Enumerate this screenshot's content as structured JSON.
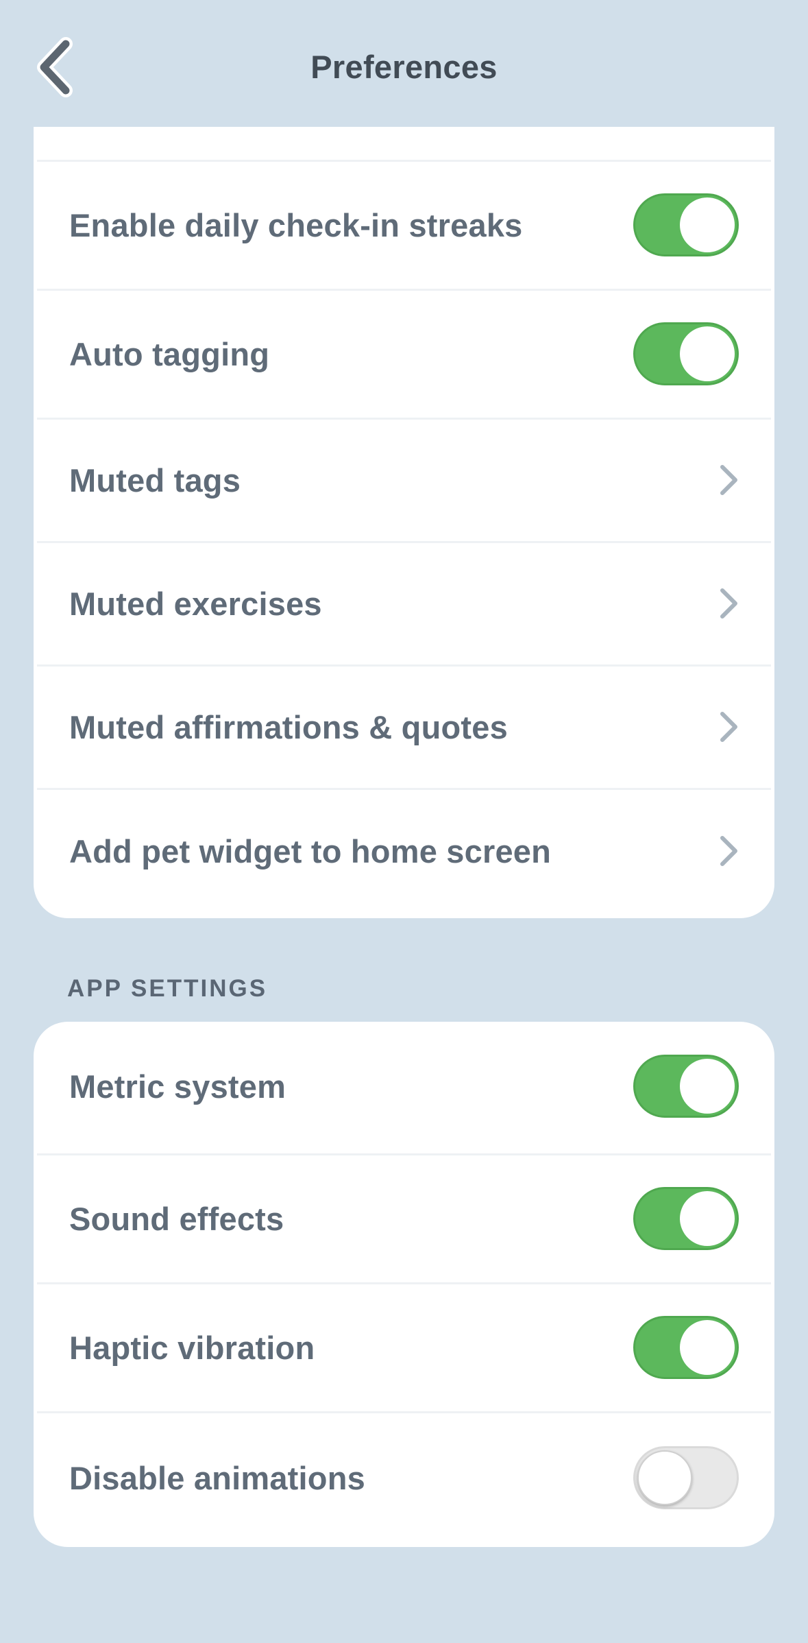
{
  "header": {
    "title": "Preferences"
  },
  "preferences": {
    "items": [
      {
        "label": "Enable daily check-in streaks",
        "control": "toggle",
        "on": true
      },
      {
        "label": "Auto tagging",
        "control": "toggle",
        "on": true
      },
      {
        "label": "Muted tags",
        "control": "chevron"
      },
      {
        "label": "Muted exercises",
        "control": "chevron"
      },
      {
        "label": "Muted affirmations & quotes",
        "control": "chevron"
      },
      {
        "label": "Add pet widget to home screen",
        "control": "chevron"
      }
    ]
  },
  "app_settings": {
    "title": "APP SETTINGS",
    "items": [
      {
        "label": "Metric system",
        "control": "toggle",
        "on": true
      },
      {
        "label": "Sound effects",
        "control": "toggle",
        "on": true
      },
      {
        "label": "Haptic vibration",
        "control": "toggle",
        "on": true
      },
      {
        "label": "Disable animations",
        "control": "toggle",
        "on": false
      }
    ]
  },
  "colors": {
    "background": "#d1dfea",
    "card": "#ffffff",
    "toggle_on": "#5cb85c",
    "toggle_off": "#e8e8e8",
    "text": "#5f6b78",
    "title": "#414b55"
  },
  "icons": {
    "back": "chevron-left-icon",
    "row_arrow": "chevron-right-icon"
  }
}
